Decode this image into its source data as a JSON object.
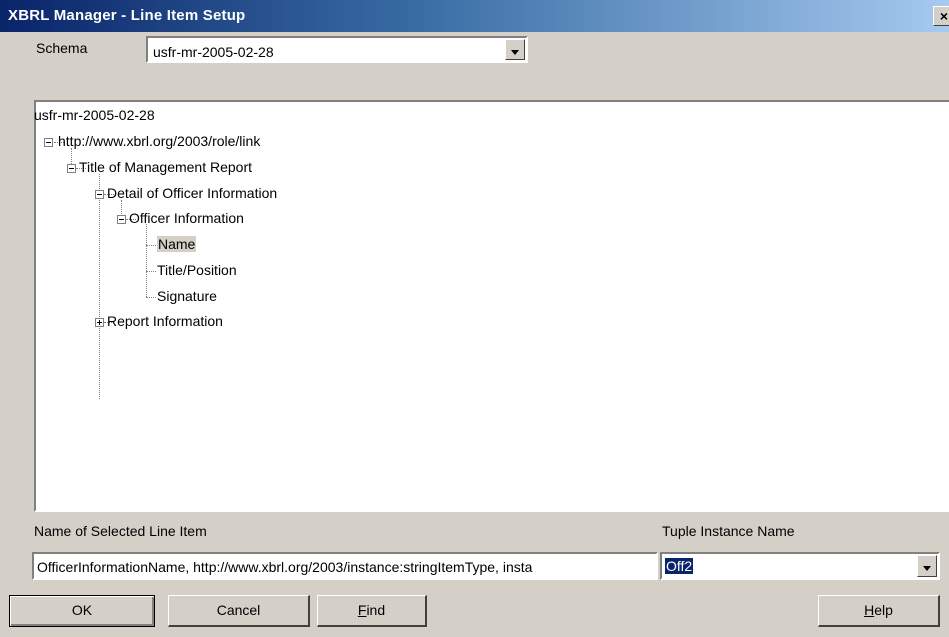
{
  "window": {
    "title": "XBRL Manager - Line Item Setup",
    "close_glyph": "×"
  },
  "schema": {
    "label": "Schema",
    "selected": "usfr-mr-2005-02-28"
  },
  "tree": {
    "root": "usfr-mr-2005-02-28",
    "link_role": "http://www.xbrl.org/2003/role/link",
    "title_mgmt": "Title of Management Report",
    "detail_officer": "Detail of Officer Information",
    "officer_info": "Officer Information",
    "name": "Name",
    "title_position": "Title/Position",
    "signature": "Signature",
    "report_info": "Report Information",
    "selected_item": "Name"
  },
  "selected_line_item": {
    "label": "Name of Selected Line Item",
    "value": "OfficerInformationName, http://www.xbrl.org/2003/instance:stringItemType, insta"
  },
  "tuple": {
    "label": "Tuple Instance Name",
    "value": "Off2"
  },
  "buttons": {
    "ok": "OK",
    "cancel": "Cancel",
    "find_prefix": "",
    "find_mnemonic": "F",
    "find_rest": "ind",
    "help_mnemonic": "H",
    "help_rest": "elp"
  }
}
